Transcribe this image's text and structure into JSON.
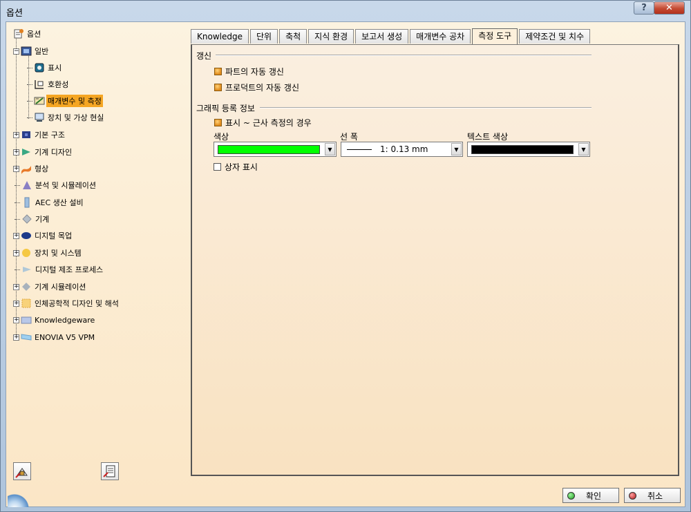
{
  "window": {
    "title": "옵션",
    "help_label": "?",
    "close_label": "✕"
  },
  "tree": {
    "items": [
      {
        "label": "옵션",
        "icon": "options-root-icon",
        "level": 0
      },
      {
        "label": "일반",
        "icon": "general-icon",
        "level": 1
      },
      {
        "label": "표시",
        "icon": "display-icon",
        "level": 2
      },
      {
        "label": "호환성",
        "icon": "compatibility-icon",
        "level": 2
      },
      {
        "label": "매개변수 및 측정",
        "icon": "parameters-measure-icon",
        "level": 2,
        "selected": true
      },
      {
        "label": "장치 및 가상 현실",
        "icon": "devices-vr-icon",
        "level": 2
      },
      {
        "label": "기본 구조",
        "icon": "infrastructure-icon",
        "level": 1
      },
      {
        "label": "기계 디자인",
        "icon": "mechanical-design-icon",
        "level": 1
      },
      {
        "label": "형상",
        "icon": "shape-icon",
        "level": 1
      },
      {
        "label": "분석 및 시뮬레이션",
        "icon": "analysis-simulation-icon",
        "level": 1
      },
      {
        "label": "AEC 생산 설비",
        "icon": "aec-plant-icon",
        "level": 1
      },
      {
        "label": "기계",
        "icon": "machining-icon",
        "level": 1
      },
      {
        "label": "디지털 목업",
        "icon": "digital-mockup-icon",
        "level": 1
      },
      {
        "label": "장치 및 시스템",
        "icon": "equipment-systems-icon",
        "level": 1
      },
      {
        "label": "디지털 제조 프로세스",
        "icon": "digital-process-icon",
        "level": 1
      },
      {
        "label": "기계 시뮬레이션",
        "icon": "machining-simulation-icon",
        "level": 1
      },
      {
        "label": "인체공학적 디자인 및 해석",
        "icon": "ergonomics-icon",
        "level": 1
      },
      {
        "label": "Knowledgeware",
        "icon": "knowledgeware-icon",
        "level": 1
      },
      {
        "label": "ENOVIA V5 VPM",
        "icon": "enovia-icon",
        "level": 1
      }
    ]
  },
  "tabs": [
    "Knowledge",
    "단위",
    "축척",
    "지식 환경",
    "보고서 생성",
    "매개변수 공차",
    "측정 도구",
    "제약조건 및 치수"
  ],
  "active_tab": "측정 도구",
  "update": {
    "title": "갱신",
    "auto_update_part": "파트의 자동 갱신",
    "auto_update_product": "프로덕트의 자동 갱신"
  },
  "graphic": {
    "title": "그래픽 등록 정보",
    "show_when_approx": "표시 ~ 근사 측정의 경우",
    "color_label": "색상",
    "color_value": "#00ff00",
    "linewidth_label": "선 폭",
    "linewidth_value": "1: 0.13 mm",
    "textcolor_label": "텍스트 색상",
    "textcolor_value": "#000000",
    "show_box": "상자 표시"
  },
  "buttons": {
    "ok": "확인",
    "cancel": "취소"
  },
  "colors": {
    "selected_bg": "#f5a623",
    "ok_dot": "#2cb52c",
    "cancel_dot": "#d22c2c"
  }
}
